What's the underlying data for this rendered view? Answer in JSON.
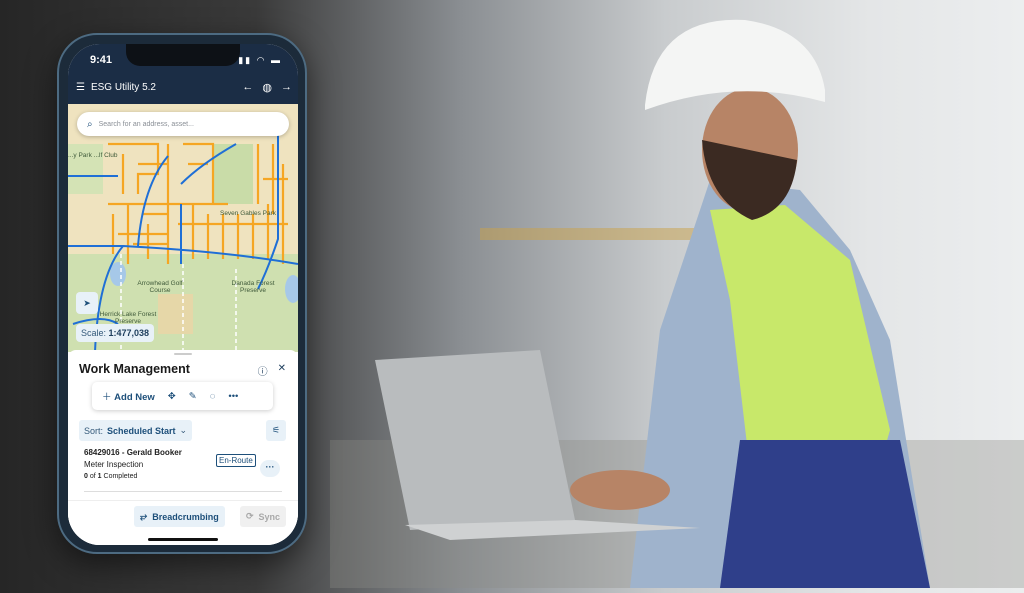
{
  "status": {
    "time": "9:41"
  },
  "app": {
    "title": "ESG Utility 5.2"
  },
  "search": {
    "placeholder": "Search for an address, asset..."
  },
  "map": {
    "labels": [
      "...y Park ...lf Club",
      "Seven Gables Park",
      "Arrowhead Golf Course",
      "Danada Forest Preserve",
      "Herrick Lake Forest Preserve"
    ],
    "scale_label": "Scale:",
    "scale_value": "1:477,038",
    "colors": {
      "water_lines": "#1f6fd6",
      "gas_lines": "#f5a623"
    }
  },
  "panel": {
    "title": "Work Management",
    "add_new": "Add New",
    "sort_label": "Sort:",
    "sort_value": "Scheduled Start",
    "work_order": {
      "title": "68429016 - Gerald Booker",
      "type": "Meter Inspection",
      "done": "0",
      "of": "of",
      "total": "1",
      "completed": "Completed",
      "status": "En-Route"
    },
    "breadcrumbing": "Breadcrumbing",
    "sync": "Sync"
  },
  "accent": "#1d4f7a"
}
